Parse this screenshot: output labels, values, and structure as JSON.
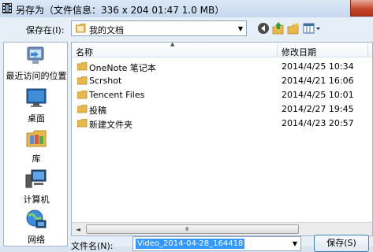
{
  "window": {
    "title": "另存为（文件信息：336 x 204   01:47   1.0 MB）"
  },
  "save_in": {
    "label": "保存在(I):",
    "value": "我的文档"
  },
  "places": [
    {
      "label": "最近访问的位置",
      "icon": "recent-places-icon"
    },
    {
      "label": "桌面",
      "icon": "desktop-icon"
    },
    {
      "label": "库",
      "icon": "libraries-icon"
    },
    {
      "label": "计算机",
      "icon": "computer-icon"
    },
    {
      "label": "网络",
      "icon": "network-icon"
    }
  ],
  "columns": {
    "name": "名称",
    "modified": "修改日期"
  },
  "files": [
    {
      "name": "OneNote 笔记本",
      "modified": "2014/4/25 10:34"
    },
    {
      "name": "Scrshot",
      "modified": "2014/4/21 16:06"
    },
    {
      "name": "Tencent Files",
      "modified": "2014/4/25 10:01"
    },
    {
      "name": "投稿",
      "modified": "2014/2/27 19:45"
    },
    {
      "name": "新建文件夹",
      "modified": "2014/4/23 20:57"
    }
  ],
  "scrollbar": {
    "left_arrow": "◄",
    "grip": "III"
  },
  "filename": {
    "label": "文件名(N):",
    "value": "Video_2014-04-28_164418"
  },
  "buttons": {
    "save": "保存(S)"
  },
  "colors": {
    "folder": "#e8b84a",
    "selection": "#3399ff",
    "close": "#c7482d"
  }
}
